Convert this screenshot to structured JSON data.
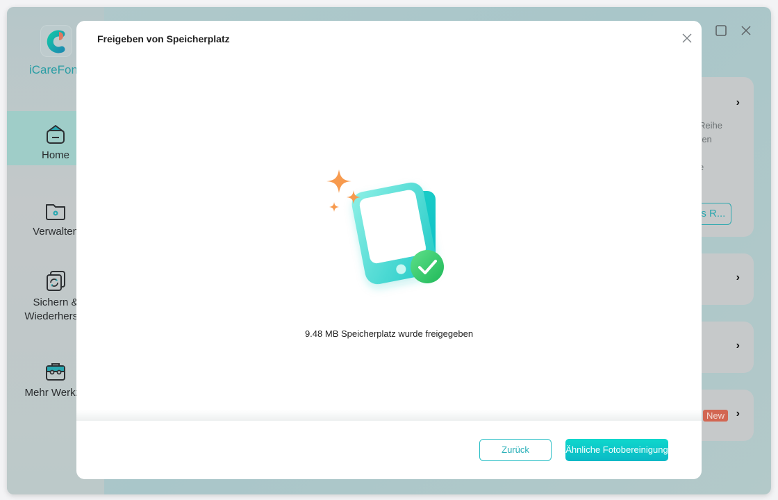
{
  "app": {
    "name": "iCareFone",
    "window_controls": [
      "minimize",
      "maximize",
      "close"
    ]
  },
  "sidebar": {
    "items": [
      {
        "label": "Home",
        "icon": "home-icon",
        "active": true
      },
      {
        "label": "Verwalten",
        "icon": "folder-gear-icon",
        "active": false
      },
      {
        "label": "Sichern &",
        "label2": "Wiederherste",
        "icon": "backup-restore-icon",
        "active": false
      },
      {
        "label": "Mehr Werkze",
        "icon": "toolbox-icon",
        "active": false
      }
    ]
  },
  "background_cards": {
    "card1": {
      "lines": [
        "Reihe",
        "ren",
        "e"
      ],
      "button_label": "os R..."
    },
    "card4": {
      "badge": "New"
    }
  },
  "modal": {
    "title": "Freigeben von Speicherplatz",
    "result_message": "9.48 MB Speicherplatz wurde freigegeben",
    "freed_amount": "9.48 MB",
    "back_label": "Zurück",
    "primary_label": "Ähnliche Fotobereinigung"
  },
  "colors": {
    "accent": "#0bc4c6",
    "success": "#2ec265",
    "badge": "#d26652",
    "sparkle": "#f7914a"
  }
}
